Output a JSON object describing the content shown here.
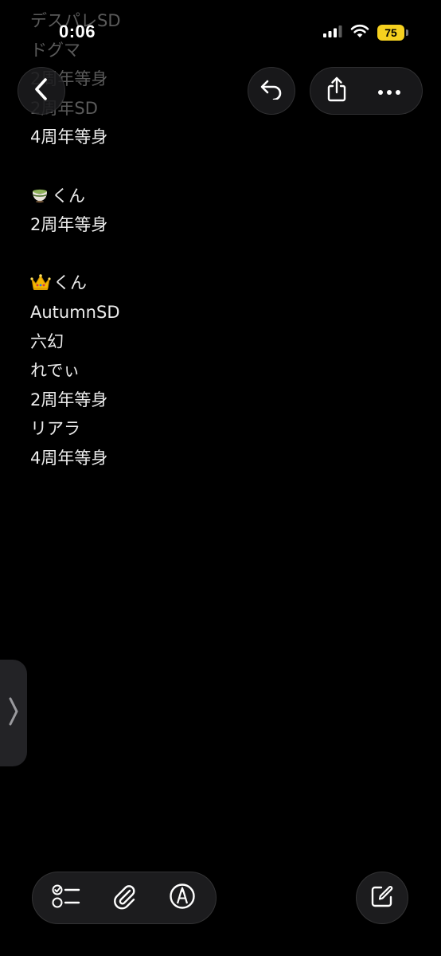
{
  "status_bar": {
    "time": "0:06",
    "battery_level": "75",
    "icons": [
      "cellular-signal-icon",
      "wifi-icon",
      "battery-icon"
    ],
    "battery_color": "#f6d11f"
  },
  "nav": {
    "back_icon": "chevron-left-icon",
    "undo_icon": "undo-arrow-icon",
    "share_icon": "share-icon",
    "more_icon": "ellipsis-icon"
  },
  "note": {
    "lines": [
      {
        "text": "デスパレSD",
        "faded": true
      },
      {
        "text": "ドグマ",
        "faded": true
      },
      {
        "text": "2周年等身",
        "faded": true
      },
      {
        "text": "2周年SD",
        "faded": true
      },
      {
        "text": "4周年等身",
        "faded": false
      },
      {
        "text": "",
        "faded": false
      },
      {
        "text": "くん",
        "faded": false,
        "emoji": "teacup"
      },
      {
        "text": "2周年等身",
        "faded": false
      },
      {
        "text": "",
        "faded": false
      },
      {
        "text": "くん",
        "faded": false,
        "emoji": "crown"
      },
      {
        "text": "AutumnSD",
        "faded": false
      },
      {
        "text": "六幻",
        "faded": false
      },
      {
        "text": "れでぃ",
        "faded": false
      },
      {
        "text": "2周年等身",
        "faded": false
      },
      {
        "text": "リアラ",
        "faded": false
      },
      {
        "text": "4周年等身",
        "faded": false
      }
    ]
  },
  "side_handle": {
    "icon": "chevron-right-icon"
  },
  "toolbar": {
    "items": [
      "checklist-icon",
      "paperclip-icon",
      "markup-pen-icon"
    ],
    "compose_icon": "compose-icon"
  }
}
